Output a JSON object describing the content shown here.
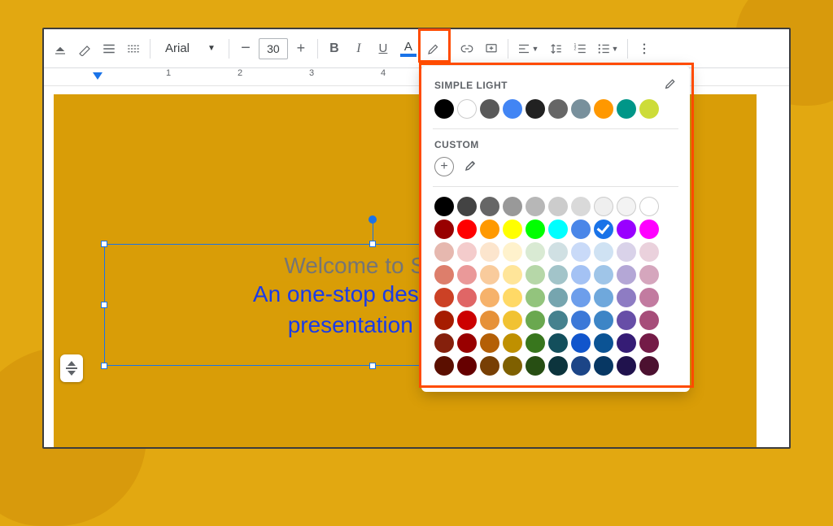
{
  "toolbar": {
    "font_family": "Arial",
    "font_size": "30",
    "buttons": {
      "bold": "B",
      "italic": "I",
      "underline": "U",
      "text_color": "A"
    }
  },
  "ruler": {
    "numbers": [
      "1",
      "2",
      "3",
      "4"
    ]
  },
  "slide": {
    "line1": "Welcome to Slide",
    "line2a": "An one-stop destination ",
    "line2b": "presentation nee"
  },
  "color_panel": {
    "theme_label": "SIMPLE LIGHT",
    "custom_label": "CUSTOM",
    "theme_colors": [
      "#000000",
      "#ffffff",
      "#595959",
      "#4285f4",
      "#212121",
      "#666666",
      "#78909c",
      "#ff9800",
      "#009688",
      "#cddc39"
    ],
    "selected_standard": "#1a73e8",
    "standard_grid": [
      [
        "#000000",
        "#434343",
        "#666666",
        "#999999",
        "#b7b7b7",
        "#cccccc",
        "#d9d9d9",
        "#efefef",
        "#f3f3f3",
        "#ffffff"
      ],
      [
        "#980000",
        "#ff0000",
        "#ff9900",
        "#ffff00",
        "#00ff00",
        "#00ffff",
        "#4a86e8",
        "#1a73e8",
        "#9900ff",
        "#ff00ff"
      ],
      [
        "#e6b8af",
        "#f4cccc",
        "#fce5cd",
        "#fff2cc",
        "#d9ead3",
        "#d0e0e3",
        "#c9daf8",
        "#cfe2f3",
        "#d9d2e9",
        "#ead1dc"
      ],
      [
        "#dd7e6b",
        "#ea9999",
        "#f9cb9c",
        "#ffe599",
        "#b6d7a8",
        "#a2c4c9",
        "#a4c2f4",
        "#9fc5e8",
        "#b4a7d6",
        "#d5a6bd"
      ],
      [
        "#cc4125",
        "#e06666",
        "#f6b26b",
        "#ffd966",
        "#93c47d",
        "#76a5af",
        "#6d9eeb",
        "#6fa8dc",
        "#8e7cc3",
        "#c27ba0"
      ],
      [
        "#a61c00",
        "#cc0000",
        "#e69138",
        "#f1c232",
        "#6aa84f",
        "#45818e",
        "#3c78d8",
        "#3d85c6",
        "#674ea7",
        "#a64d79"
      ],
      [
        "#85200c",
        "#990000",
        "#b45f06",
        "#bf9000",
        "#38761d",
        "#134f5c",
        "#1155cc",
        "#0b5394",
        "#351c75",
        "#741b47"
      ],
      [
        "#5b0f00",
        "#660000",
        "#783f04",
        "#7f6000",
        "#274e13",
        "#0c343d",
        "#1c4587",
        "#073763",
        "#20124d",
        "#4c1130"
      ]
    ]
  }
}
